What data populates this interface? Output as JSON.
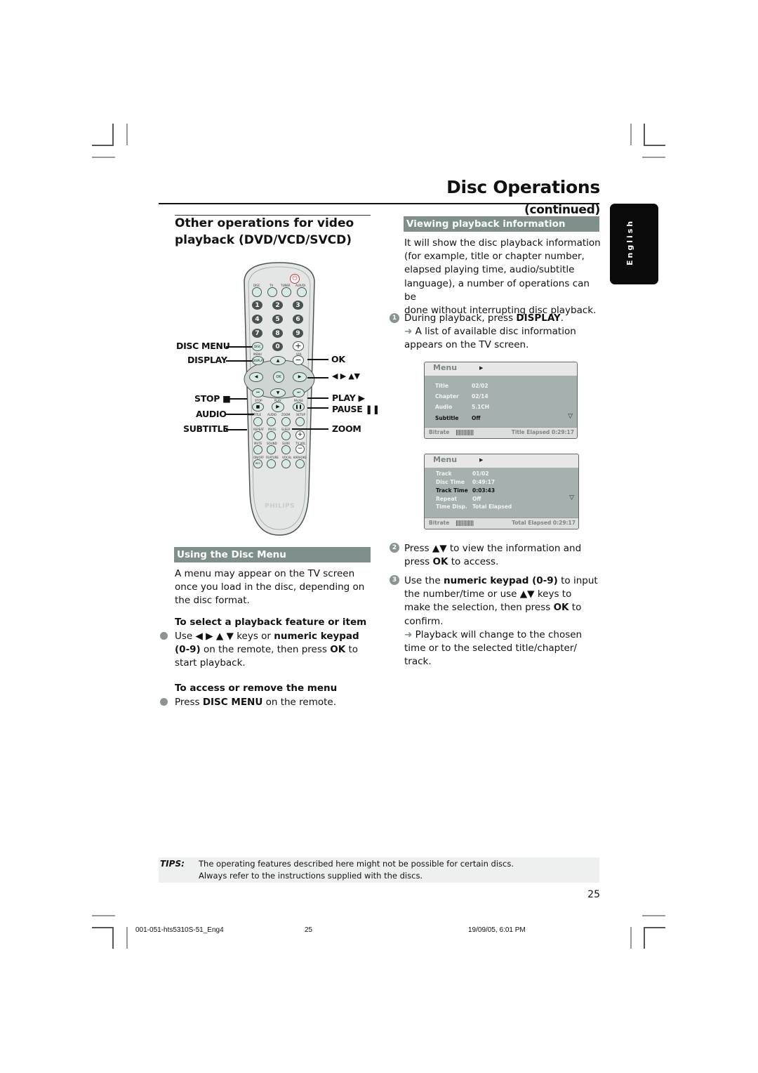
{
  "header": {
    "title": "Disc Operations",
    "title_suffix": "(continued)"
  },
  "language_tab": "English",
  "left": {
    "section_title_line1": "Other operations for video",
    "section_title_line2": "playback (DVD/VCD/SVCD)",
    "remote": {
      "brand": "PHILIPS",
      "callouts_left": [
        "DISC MENU",
        "DISPLAY",
        "STOP ■",
        "AUDIO",
        "SUBTITLE"
      ],
      "callouts_right": [
        "OK",
        "◀ ▶  ▲▼",
        "PLAY ▶",
        "PAUSE ❚❚",
        "ZOOM"
      ],
      "top_keys": [
        "DISC",
        "TV",
        "TUNER",
        "AUX/DI"
      ],
      "number_keys": [
        "1",
        "2",
        "3",
        "4",
        "5",
        "6",
        "7",
        "8",
        "9",
        "0"
      ],
      "small_labels": [
        "MENU",
        "VOL",
        "STOP",
        "PLAY",
        "PAUSE",
        "SUBTITLE",
        "AUDIO",
        "ZOOM",
        "SETUP",
        "REPEAT",
        "PROG",
        "SLEEP",
        "MUTE",
        "SOUND",
        "SURR",
        "TV VOL",
        "ON/OFF",
        "FEATURE",
        "VOCAL",
        "KARAOKE"
      ],
      "center_keys": {
        "disc": "DISC",
        "display": "DISPLAY",
        "ok": "OK",
        "plus": "+",
        "minus": "−",
        "rec": "REC"
      }
    },
    "disc_menu_band": "Using the Disc Menu",
    "disc_menu_intro": [
      "A menu may appear on the TV screen",
      "once you load in the disc, depending on",
      "the disc format."
    ],
    "select_heading": "To select a playback feature or item",
    "select_text": {
      "l1_a": "Use ◀ ▶ ▲ ▼ keys or ",
      "l1_b": "numeric keypad",
      "l2_a": "(0-9)",
      "l2_b": " on the remote, then press ",
      "l2_c": "OK",
      "l2_d": " to",
      "l3": "start playback."
    },
    "access_heading": "To access or remove the menu",
    "access_text": {
      "a": "Press ",
      "b": "DISC MENU",
      "c": " on the remote."
    }
  },
  "right": {
    "band": "Viewing playback information",
    "intro": [
      "It will show the disc playback information",
      "(for example, title or chapter number,",
      "elapsed playing time, audio/subtitle",
      "language), a number of operations can be",
      "done without interrupting disc playback."
    ],
    "step1": {
      "num": "1",
      "a": "During playback, press ",
      "b": "DISPLAY",
      "c": ".",
      "arrow": "➜",
      "r1": " A list of available disc information",
      "r2": "appears on the TV screen."
    },
    "osd1": {
      "menu": "Menu",
      "rows": [
        {
          "label": "Title",
          "value": "02/02",
          "selected": false
        },
        {
          "label": "Chapter",
          "value": "02/14",
          "selected": false
        },
        {
          "label": "Audio",
          "value": "5.1CH",
          "selected": false
        },
        {
          "label": "Subtitle",
          "value": "Off",
          "selected": true
        }
      ],
      "bitrate_label": "Bitrate",
      "bitrate_bars": "||||||||||||",
      "elapsed": "Title Elapsed  0:29:17"
    },
    "osd2": {
      "menu": "Menu",
      "rows": [
        {
          "label": "Track",
          "value": "01/02",
          "selected": false
        },
        {
          "label": "Disc Time",
          "value": "0:49:17",
          "selected": false
        },
        {
          "label": "Track Time",
          "value": "0:03:43",
          "selected": true
        },
        {
          "label": "Repeat",
          "value": "Off",
          "selected": false
        },
        {
          "label": "Time Disp.",
          "value": "Total Elapsed",
          "selected": false
        }
      ],
      "bitrate_label": "Bitrate",
      "bitrate_bars": "||||||||||||",
      "elapsed": "Total Elapsed  0:29:17"
    },
    "step2": {
      "num": "2",
      "l1_a": "Press ▲▼  to view the information and",
      "l2_a": "press ",
      "l2_b": "OK",
      "l2_c": " to access."
    },
    "step3": {
      "num": "3",
      "l1_a": "Use the ",
      "l1_b": "numeric keypad (0-9)",
      "l1_c": " to input",
      "l2": "the number/time or use ▲▼ keys to",
      "l3_a": "make the selection, then press ",
      "l3_b": "OK",
      "l3_c": " to",
      "l4": "confirm.",
      "arrow": "➜",
      "r1": " Playback will change to the chosen",
      "r2": "time or to the selected title/chapter/",
      "r3": "track."
    }
  },
  "tips": {
    "label": "TIPS:",
    "line1": "The operating features described here might not be possible for certain discs.",
    "line2": "Always refer to the instructions supplied with the discs."
  },
  "page_number": "25",
  "footer": {
    "file": "001-051-hts5310S-51_Eng4",
    "page": "25",
    "date": "19/09/05, 6:01 PM"
  }
}
